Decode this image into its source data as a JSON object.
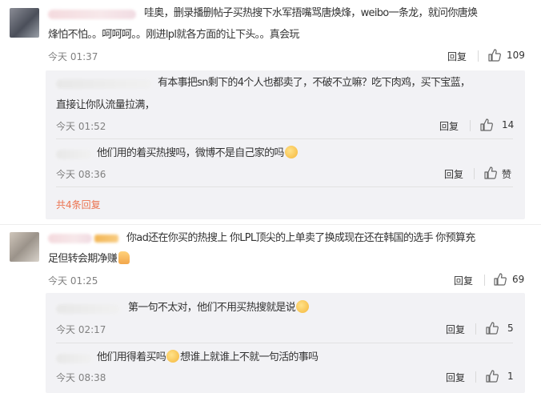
{
  "labels": {
    "reply": "回复",
    "show_more": "共4条回复"
  },
  "comments": [
    {
      "text_line1": "哇奥，删录播删帖子买热搜下水军捂嘴骂唐焕烽，weibo一条龙，就问你唐焕",
      "text_line2": "烽怕不怕。。呵呵呵。。刚进lpl就各方面的让下头。。真会玩",
      "time": "今天 01:37",
      "likes": "109",
      "replies": [
        {
          "text_line1": "有本事把sn剩下的4个人也都卖了，不破不立嘛？吃下肉鸡，买下宝蓝，",
          "text_line2": "直接让你队流量拉满，",
          "time": "今天 01:52",
          "likes": "14"
        },
        {
          "text": "他们用的着买热搜吗，微博不是自己家的吗",
          "time": "今天 08:36",
          "likes": "赞"
        }
      ]
    },
    {
      "text_line1": "你ad还在你买的热搜上 你LPL顶尖的上单卖了换成现在还在韩国的选手 你预算充",
      "text_line2": "足但转会期净赚",
      "time": "今天 01:25",
      "likes": "69",
      "replies": [
        {
          "text": "第一句不太对，他们不用买热搜就是说",
          "time": "今天 02:17",
          "likes": "5"
        },
        {
          "text_a": "他们用得着买吗",
          "text_b": "想谁上就谁上不就一句活的事吗",
          "time": "今天 08:38",
          "likes": "1"
        }
      ]
    }
  ]
}
